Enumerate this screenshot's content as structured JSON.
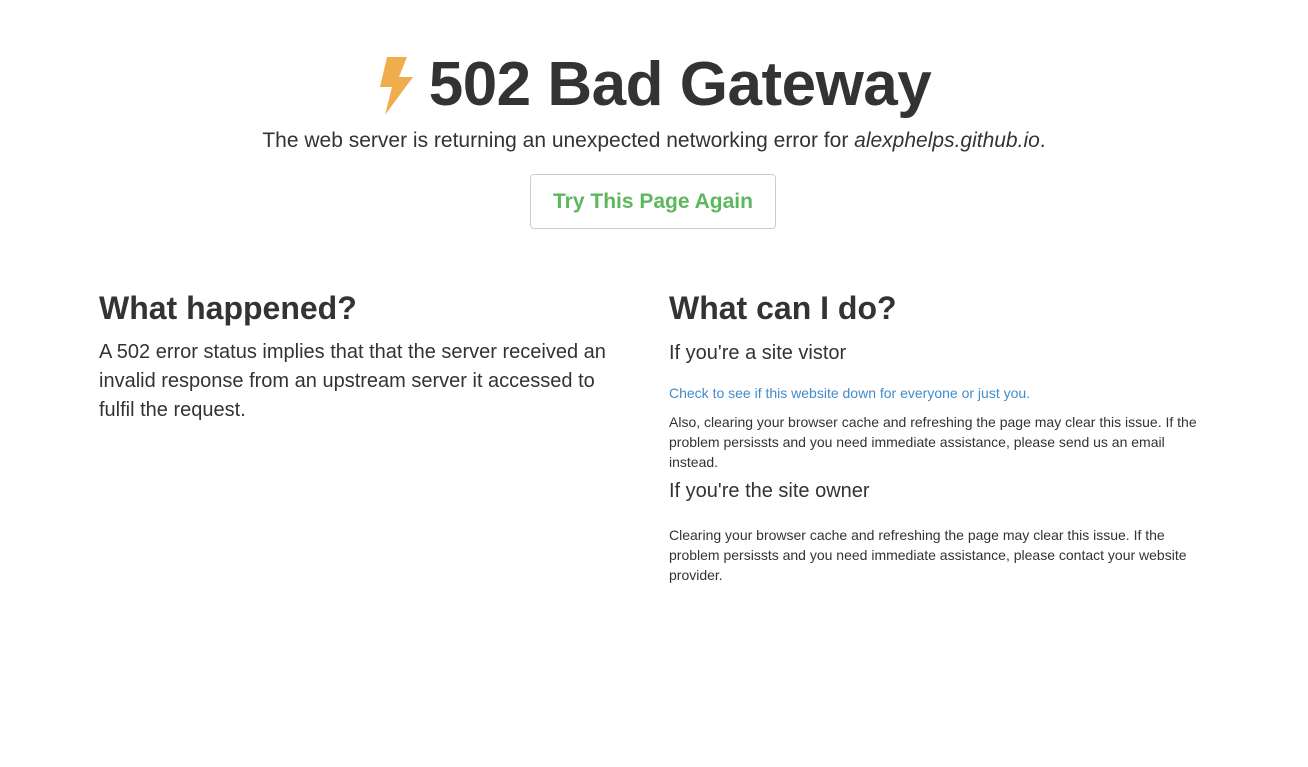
{
  "header": {
    "icon": "lightning-bolt-icon",
    "title": "502 Bad Gateway",
    "subtitle_prefix": "The web server is returning an unexpected networking error for ",
    "subtitle_domain": "alexphelps.github.io",
    "subtitle_suffix": ".",
    "accent_color": "#f0ad4e"
  },
  "retry_button": {
    "label": "Try This Page Again",
    "color": "#5cb85c"
  },
  "what_happened": {
    "heading": "What happened?",
    "body": "A 502 error status implies that that the server received an invalid response from an upstream server it accessed to fulfil the request."
  },
  "what_can_i_do": {
    "heading": "What can I do?",
    "visitor_heading": "If you're a site vistor",
    "visitor_link": "Check to see if this website down for everyone or just you.",
    "visitor_text": "Also, clearing your browser cache and refreshing the page may clear this issue. If the problem persissts and you need immediate assistance, please send us an email instead.",
    "owner_heading": "If you're the site owner",
    "owner_text": "Clearing your browser cache and refreshing the page may clear this issue. If the problem persissts and you need immediate assistance, please contact your website provider.",
    "link_color": "#428bca"
  }
}
